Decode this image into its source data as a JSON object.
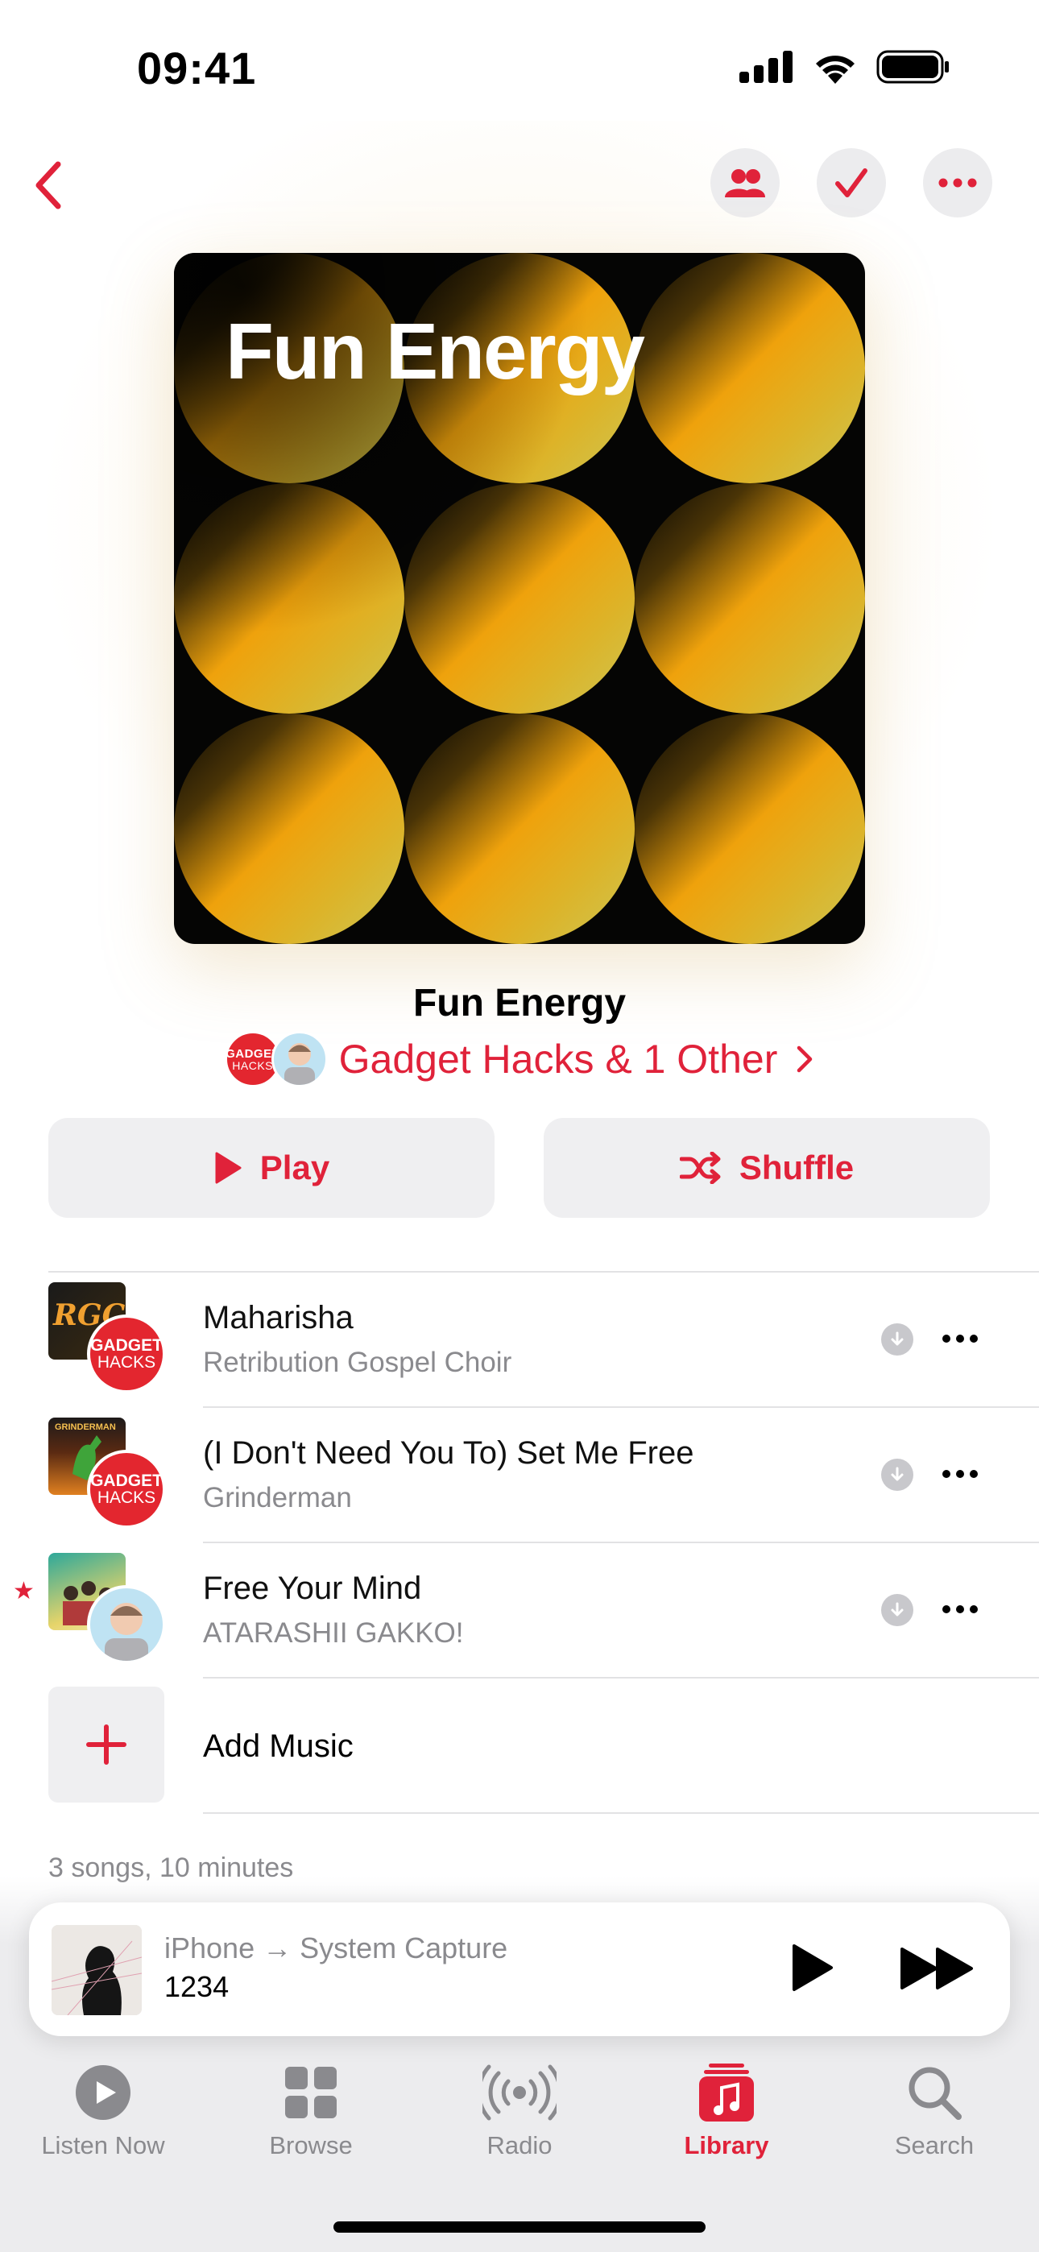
{
  "status_bar": {
    "time": "09:41"
  },
  "header": {
    "back_icon": "chevron-left-icon",
    "actions": [
      "collaborators-icon",
      "checkmark-icon",
      "more-icon"
    ],
    "accent": "#e0223a"
  },
  "artwork": {
    "title": "Fun Energy"
  },
  "playlist": {
    "title": "Fun Energy",
    "curators": "Gadget Hacks & 1 Other",
    "avatar_text": [
      "GADGET",
      "HACKS"
    ]
  },
  "buttons": {
    "play": "Play",
    "shuffle": "Shuffle"
  },
  "songs": [
    {
      "title": "Maharisha",
      "artist": "Retribution Gospel Choir",
      "thumb_text": "RGC",
      "added_by": "Gadget Hacks"
    },
    {
      "title": "(I Don't Need You To) Set Me Free",
      "artist": "Grinderman",
      "thumb_text": "GRINDERMAN",
      "added_by": "Gadget Hacks"
    },
    {
      "title": "Free Your Mind",
      "artist": "ATARASHII GAKKO!",
      "added_by": "memoji",
      "starred": true
    }
  ],
  "add_music": "Add Music",
  "summary": "3 songs, 10 minutes",
  "now_playing": {
    "source": "iPhone → System Capture",
    "title": "1234"
  },
  "tabs": [
    {
      "label": "Listen Now",
      "icon": "play-circle-icon"
    },
    {
      "label": "Browse",
      "icon": "grid-icon"
    },
    {
      "label": "Radio",
      "icon": "radio-waves-icon"
    },
    {
      "label": "Library",
      "icon": "music-library-icon",
      "active": true
    },
    {
      "label": "Search",
      "icon": "search-icon"
    }
  ]
}
